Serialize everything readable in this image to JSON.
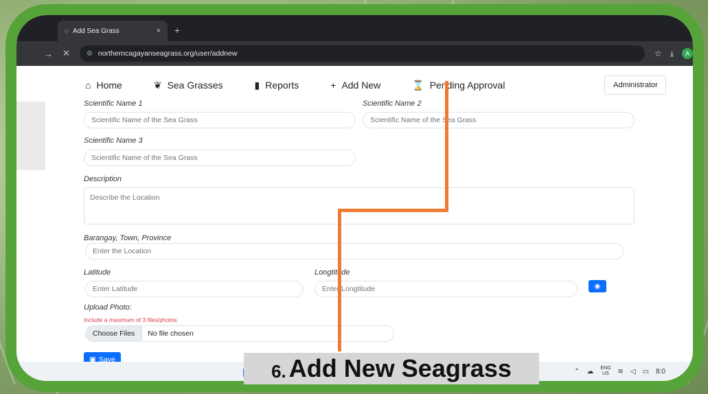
{
  "browser": {
    "tab_title": "Add Sea Grass",
    "tab_close": "×",
    "new_tab": "+",
    "url": "northerncagayanseagrass.org/user/addnew",
    "profile_initial": "A"
  },
  "navbar": {
    "home": "Home",
    "sea_grasses": "Sea Grasses",
    "reports": "Reports",
    "add_new": "Add New",
    "pending_approval": "Pending Approval",
    "admin": "Administrator"
  },
  "form": {
    "sci_name_1_label": "Scientific Name 1",
    "sci_name_1_placeholder": "Scientific Name of the Sea Grass",
    "sci_name_2_label": "Scientific Name 2",
    "sci_name_2_placeholder": "Scientific Name of the Sea Grass",
    "sci_name_3_label": "Scientific Name 3",
    "sci_name_3_placeholder": "Scientific Name of the Sea Grass",
    "description_label": "Description",
    "description_placeholder": "Describe the Location",
    "location_label": "Barangay, Town, Province",
    "location_placeholder": "Enter the Location",
    "latitude_label": "Latitude",
    "latitude_placeholder": "Enter Latitude",
    "longitude_label": "Longtitude",
    "longitude_placeholder": "Enter Longtitude",
    "upload_label": "Upload Photo:",
    "upload_hint": "Include a maximum of 3 files/photos.",
    "choose_files": "Choose Files",
    "no_file": "No file chosen",
    "save": "Save"
  },
  "taskbar": {
    "lang_top": "ENG",
    "lang_bottom": "US",
    "time": "8:0"
  },
  "caption": {
    "number": "6.",
    "text": "Add New Seagrass"
  },
  "colors": {
    "frame": "#56a33a",
    "annotation": "#ee7a33",
    "primary": "#0d6efd"
  }
}
